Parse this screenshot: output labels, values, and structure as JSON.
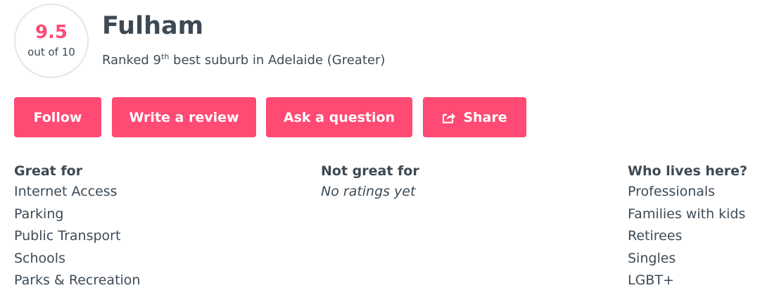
{
  "score": {
    "value": "9.5",
    "sub_label": "out of 10"
  },
  "suburb": {
    "name": "Fulham",
    "rank_prefix": "Ranked 9",
    "rank_suffix": "th",
    "rank_rest": " best suburb in Adelaide (Greater)"
  },
  "actions": {
    "follow_label": "Follow",
    "review_label": "Write a review",
    "ask_label": "Ask a question",
    "share_label": "Share",
    "share_icon": "share-icon"
  },
  "great_for": {
    "heading": "Great for",
    "items": [
      "Internet Access",
      "Parking",
      "Public Transport",
      "Schools",
      "Parks & Recreation"
    ]
  },
  "not_great_for": {
    "heading": "Not great for",
    "empty_text": "No ratings yet"
  },
  "who_lives_here": {
    "heading": "Who lives here?",
    "items": [
      "Professionals",
      "Families with kids",
      "Retirees",
      "Singles",
      "LGBT+"
    ]
  },
  "colors": {
    "accent": "#ff4a73",
    "text": "#3d4a55",
    "circle_border": "#e3e6e8"
  }
}
